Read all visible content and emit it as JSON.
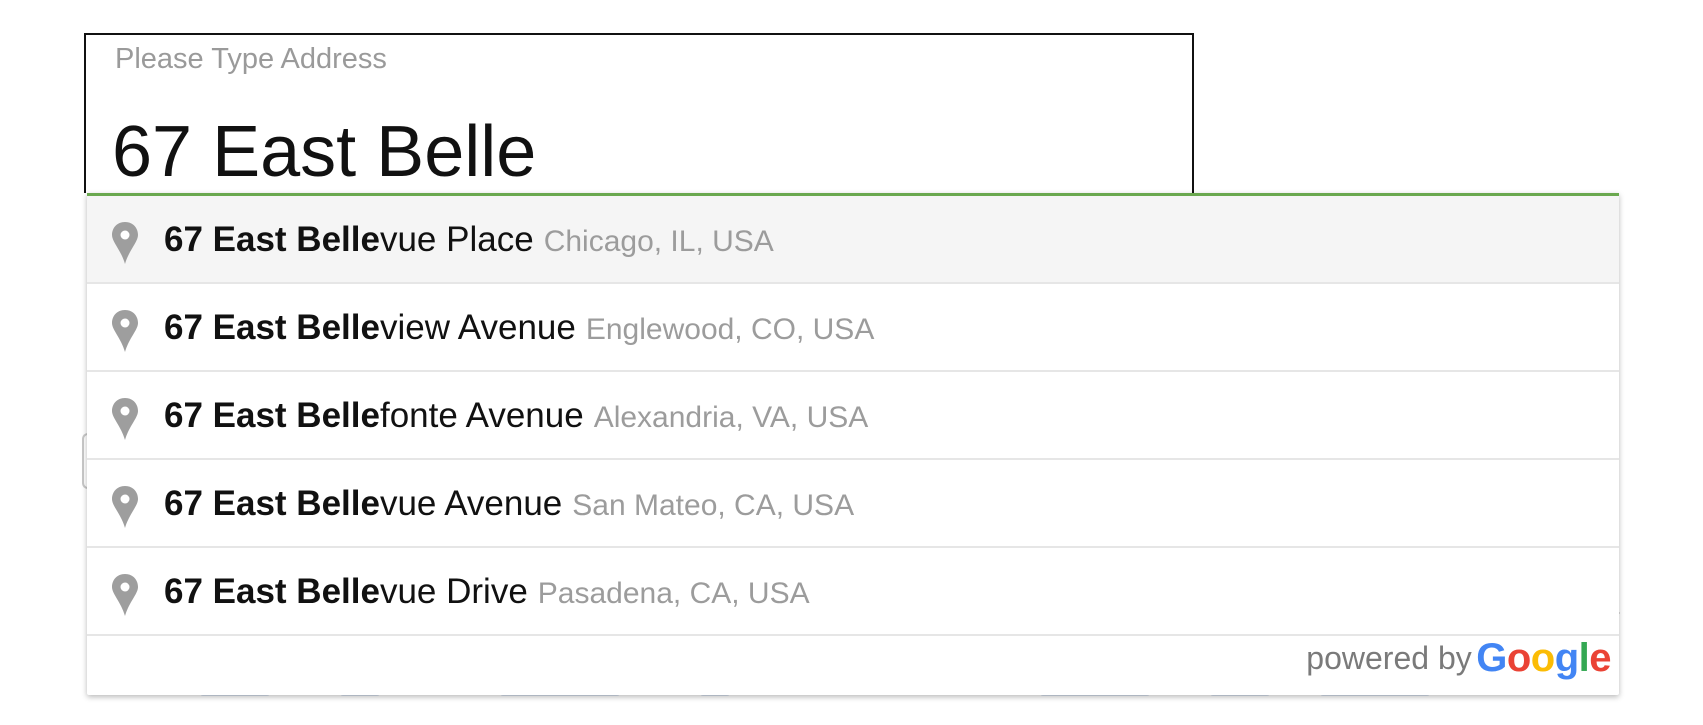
{
  "address": {
    "label": "Please Type Address",
    "value": "67 East Belle"
  },
  "suggestions": [
    {
      "match": "67 East Belle",
      "rest": "vue Place",
      "secondary": "Chicago, IL, USA",
      "icon": "map-pin-icon"
    },
    {
      "match": "67 East Belle",
      "rest": "view Avenue",
      "secondary": "Englewood, CO, USA",
      "icon": "map-pin-icon"
    },
    {
      "match": "67 East Belle",
      "rest": "fonte Avenue",
      "secondary": "Alexandria, VA, USA",
      "icon": "map-pin-icon"
    },
    {
      "match": "67 East Belle",
      "rest": "vue Avenue",
      "secondary": "San Mateo, CA, USA",
      "icon": "map-pin-icon"
    },
    {
      "match": "67 East Belle",
      "rest": "vue Drive",
      "secondary": "Pasadena, CA, USA",
      "icon": "map-pin-icon"
    }
  ],
  "attribution": {
    "text": "powered by",
    "brand_letters": [
      "G",
      "o",
      "o",
      "g",
      "l",
      "e"
    ],
    "brand_colors": [
      "#4285F4",
      "#EA4335",
      "#FBBC05",
      "#4285F4",
      "#34A853",
      "#EA4335"
    ]
  },
  "colors": {
    "focus_accent": "#6aa84f",
    "pin_gray": "#9e9e9e",
    "secondary_text": "#9c9c9c",
    "selected_row": "#f5f5f5"
  }
}
